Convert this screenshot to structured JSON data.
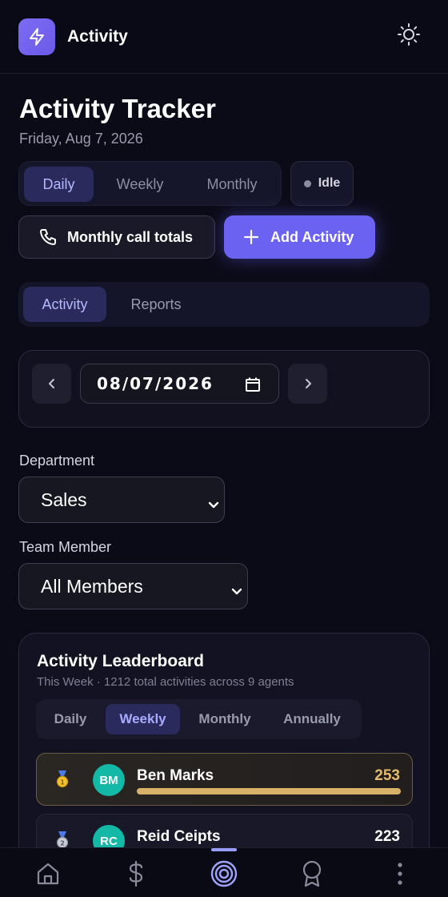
{
  "header": {
    "app_title": "Activity",
    "logo_icon": "lightning-icon",
    "theme_icon": "sun-icon"
  },
  "page": {
    "title": "Activity Tracker",
    "date": "Friday, Aug 7, 2026"
  },
  "period_tabs": {
    "items": [
      "Daily",
      "Weekly",
      "Monthly"
    ],
    "selected": "Daily"
  },
  "status": {
    "label": "Idle"
  },
  "actions": {
    "call_totals": "Monthly call totals",
    "add_activity": "Add Activity"
  },
  "view_tabs": {
    "items": [
      "Activity",
      "Reports"
    ],
    "selected": "Activity"
  },
  "date_picker": {
    "value": "08/07/2026"
  },
  "filters": {
    "department_label": "Department",
    "department_value": "Sales",
    "member_label": "Team Member",
    "member_value": "All Members"
  },
  "leaderboard": {
    "title": "Activity Leaderboard",
    "subtitle": "This Week · 1212 total activities across 9 agents",
    "tabs": [
      "Daily",
      "Weekly",
      "Monthly",
      "Annually"
    ],
    "selected_tab": "Weekly",
    "rows": [
      {
        "rank_icon": "gold-medal-icon",
        "initials": "BM",
        "name": "Ben Marks",
        "score": "253",
        "fraction": 1.0,
        "bar_color": "#d9b26a",
        "score_color": "#e3bb6b"
      },
      {
        "rank_icon": "silver-medal-icon",
        "initials": "RC",
        "name": "Reid Ceipts",
        "score": "223",
        "fraction": 0.88,
        "bar_color": "#14b8a6",
        "score_color": "#ffffff"
      }
    ]
  },
  "colors": {
    "accent": "#6c62f2",
    "background": "#0b0b18",
    "teal": "#14b8a6",
    "gold": "#d9b26a"
  },
  "bottom_nav": {
    "items": [
      "home-icon",
      "dollar-icon",
      "target-icon",
      "award-icon",
      "more-icon"
    ],
    "selected": "target-icon"
  }
}
